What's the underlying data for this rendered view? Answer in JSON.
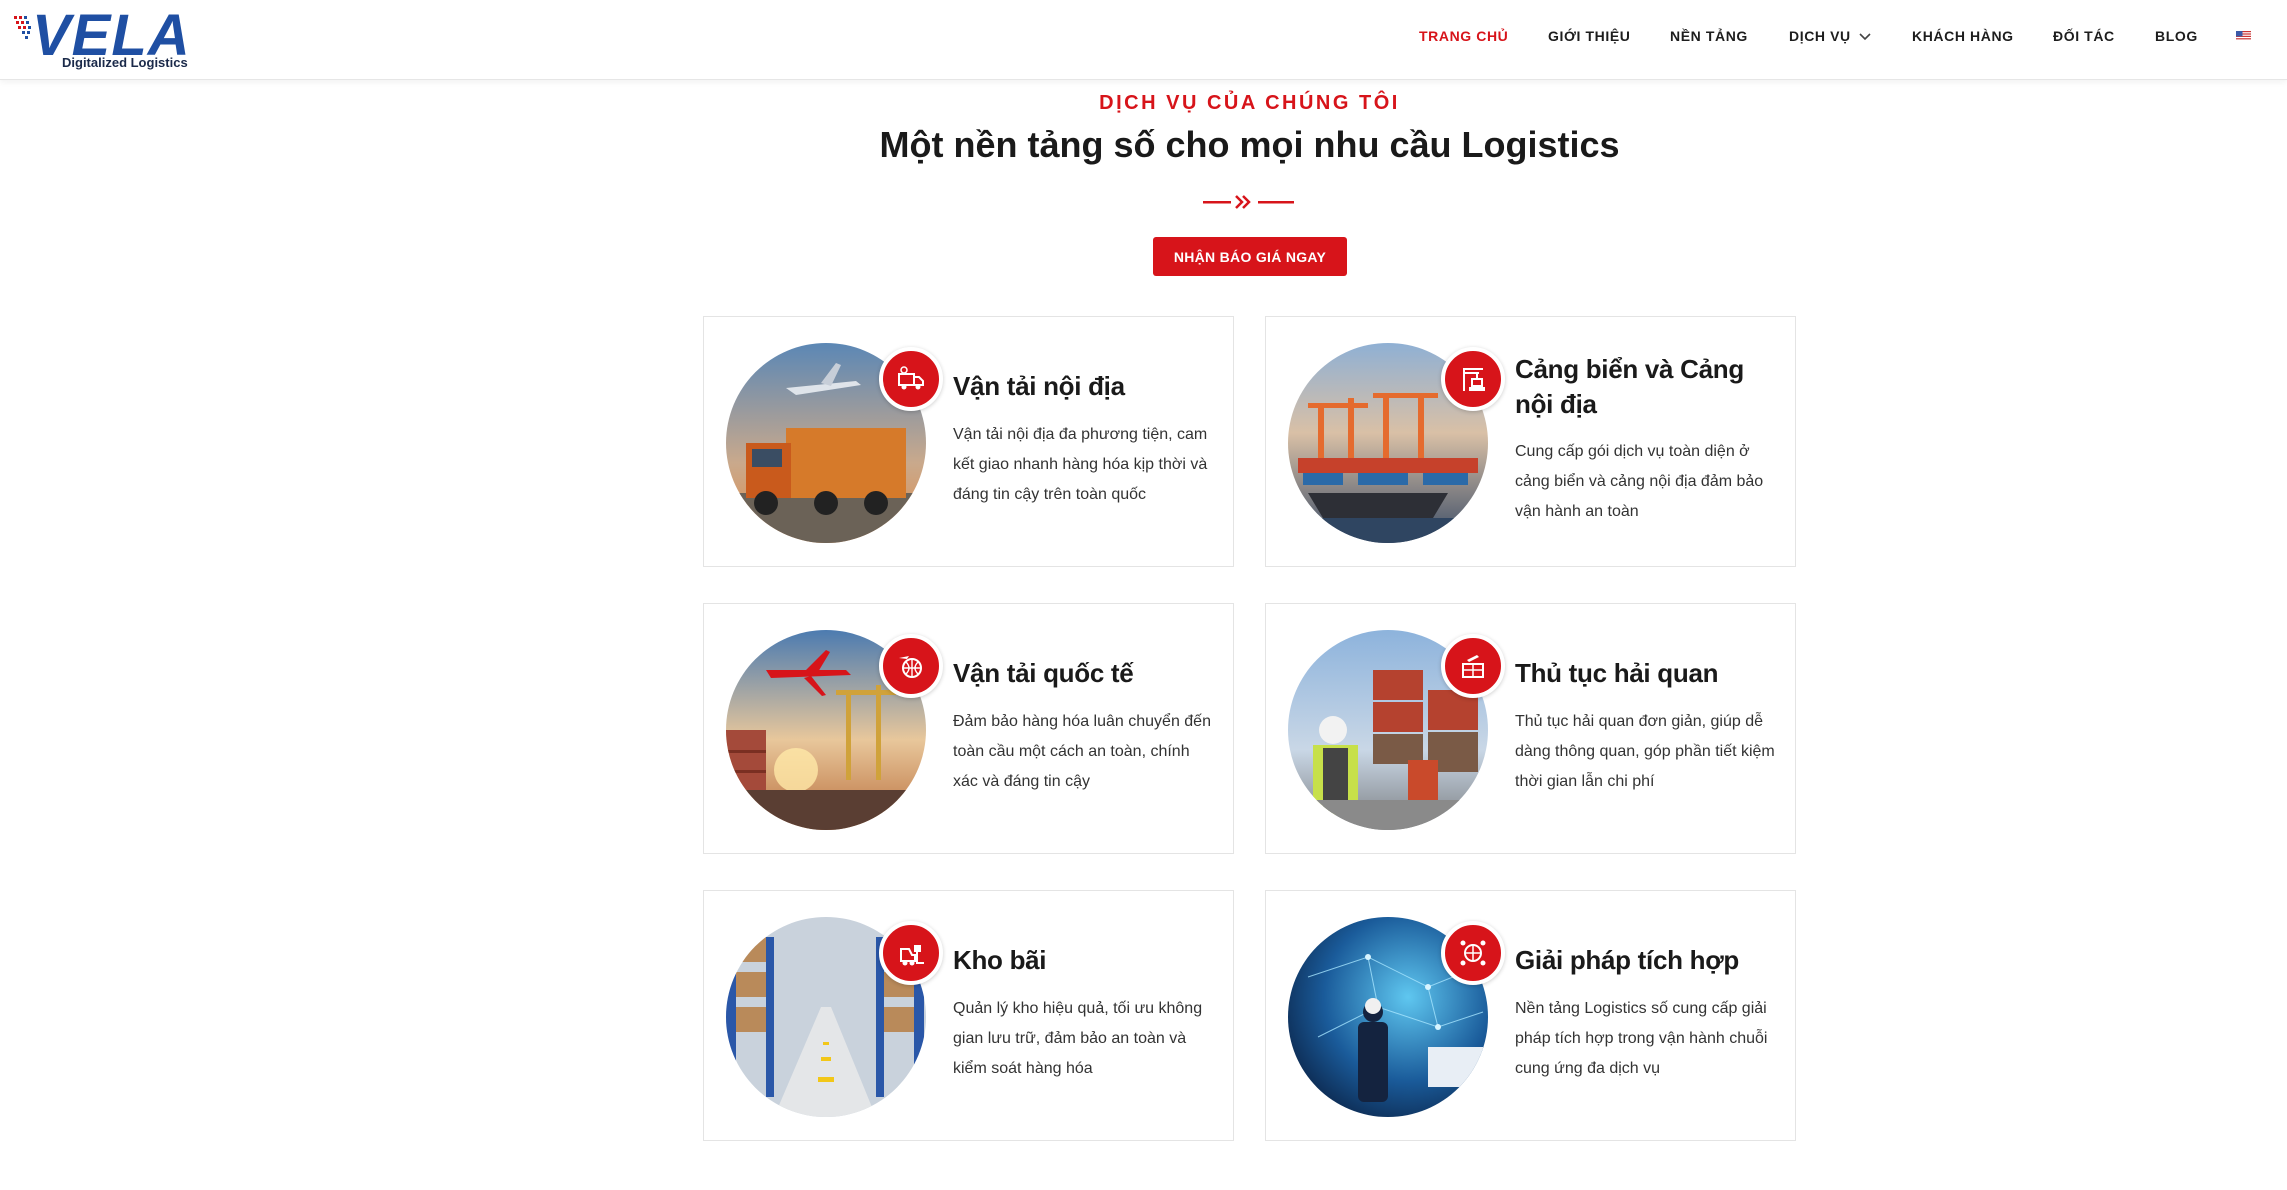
{
  "header": {
    "logo_text": "VELA",
    "logo_tagline": "Digitalized Logistics",
    "nav": [
      {
        "label": "TRANG CHỦ",
        "active": true
      },
      {
        "label": "GIỚI THIỆU"
      },
      {
        "label": "NỀN TẢNG"
      },
      {
        "label": "DỊCH VỤ",
        "has_dropdown": true
      },
      {
        "label": "KHÁCH HÀNG"
      },
      {
        "label": "ĐỐI TÁC"
      },
      {
        "label": "BLOG"
      }
    ],
    "language_icon": "us-flag-icon"
  },
  "section": {
    "eyebrow": "DỊCH VỤ CỦA CHÚNG TÔI",
    "title": "Một nền tảng số cho mọi nhu cầu Logistics",
    "cta_label": "NHẬN BÁO GIÁ NGAY"
  },
  "services": [
    {
      "title": "Vận tải nội địa",
      "desc": "Vận tải nội địa đa phương tiện, cam kết giao nhanh hàng hóa kịp thời và đáng tin cậy trên toàn quốc",
      "icon": "truck-icon"
    },
    {
      "title": "Cảng biển và Cảng nội địa",
      "desc": "Cung cấp gói dịch vụ toàn diện ở cảng biển và cảng nội địa đảm bảo vận hành an toàn",
      "icon": "port-crane-icon"
    },
    {
      "title": "Vận tải quốc tế",
      "desc": "Đảm bảo hàng hóa luân chuyển đến toàn cầu một cách an toàn, chính xác và đáng tin cậy",
      "icon": "global-shipping-icon"
    },
    {
      "title": "Thủ tục hải quan",
      "desc": "Thủ tục hải quan đơn giản, giúp dễ dàng thông quan, góp phần tiết kiệm thời gian lẫn chi phí",
      "icon": "customs-icon"
    },
    {
      "title": "Kho bãi",
      "desc": "Quản lý kho hiệu quả, tối ưu không gian lưu trữ, đảm bảo an toàn và kiểm soát hàng hóa",
      "icon": "forklift-icon"
    },
    {
      "title": "Giải pháp tích hợp",
      "desc": "Nền tảng Logistics số cung cấp giải pháp tích hợp trong vận hành chuỗi cung ứng đa dịch vụ",
      "icon": "network-icon"
    }
  ],
  "colors": {
    "accent": "#d7141a",
    "brand_blue": "#1f4fa3"
  }
}
